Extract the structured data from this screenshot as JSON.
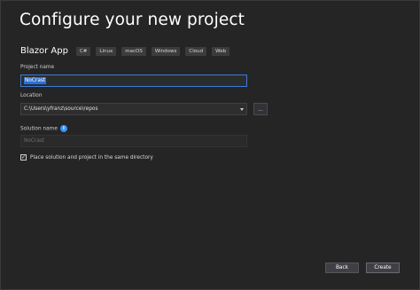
{
  "dialog": {
    "title": "Configure your new project"
  },
  "template": {
    "name": "Blazor App",
    "tags": [
      "C#",
      "Linux",
      "macOS",
      "Windows",
      "Cloud",
      "Web"
    ]
  },
  "fields": {
    "project_name": {
      "label": "Project name",
      "value": "NoCrast"
    },
    "location": {
      "label": "Location",
      "value": "C:\\Users\\yfranz\\source\\repos",
      "browse_label": "..."
    },
    "solution_name": {
      "label": "Solution name",
      "value": "NoCrast",
      "info_icon": "i"
    }
  },
  "options": {
    "same_directory": {
      "label": "Place solution and project in the same directory",
      "checked": true,
      "check_glyph": "✓"
    }
  },
  "buttons": {
    "back": "Back",
    "create": "Create"
  },
  "colors": {
    "background": "#252526",
    "accent": "#3e7bd6",
    "selection": "#2e6fd1",
    "info": "#3794ff"
  }
}
